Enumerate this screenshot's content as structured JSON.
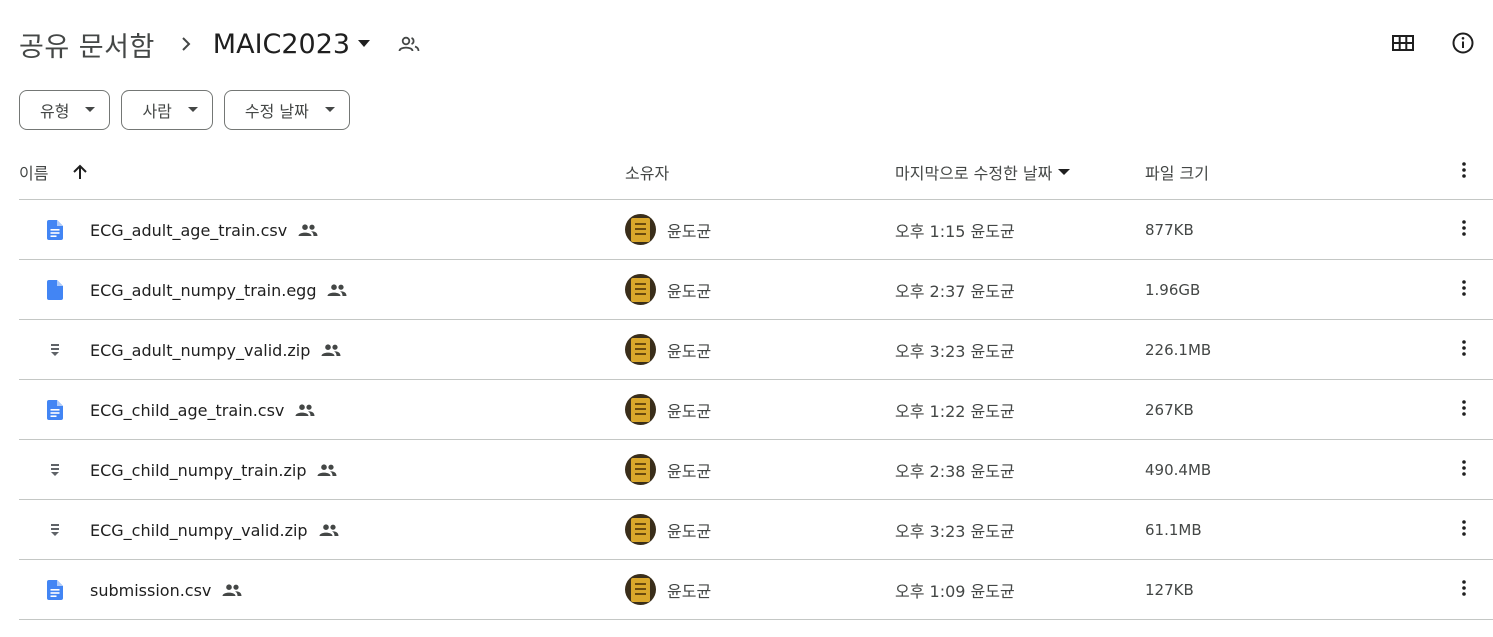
{
  "breadcrumb": {
    "root": "공유 문서함",
    "current": "MAIC2023"
  },
  "filters": [
    {
      "label": "유형"
    },
    {
      "label": "사람"
    },
    {
      "label": "수정 날짜"
    }
  ],
  "columns": {
    "name": "이름",
    "owner": "소유자",
    "modified": "마지막으로 수정한 날짜",
    "size": "파일 크기"
  },
  "files": [
    {
      "name": "ECG_adult_age_train.csv",
      "icon": "document-icon",
      "owner": "윤도균",
      "modified": "오후 1:15 윤도균",
      "size": "877KB"
    },
    {
      "name": "ECG_adult_numpy_train.egg",
      "icon": "file-icon",
      "owner": "윤도균",
      "modified": "오후 2:37 윤도균",
      "size": "1.96GB"
    },
    {
      "name": "ECG_adult_numpy_valid.zip",
      "icon": "zip-icon",
      "owner": "윤도균",
      "modified": "오후 3:23 윤도균",
      "size": "226.1MB"
    },
    {
      "name": "ECG_child_age_train.csv",
      "icon": "document-icon",
      "owner": "윤도균",
      "modified": "오후 1:22 윤도균",
      "size": "267KB"
    },
    {
      "name": "ECG_child_numpy_train.zip",
      "icon": "zip-icon",
      "owner": "윤도균",
      "modified": "오후 2:38 윤도균",
      "size": "490.4MB"
    },
    {
      "name": "ECG_child_numpy_valid.zip",
      "icon": "zip-icon",
      "owner": "윤도균",
      "modified": "오후 3:23 윤도균",
      "size": "61.1MB"
    },
    {
      "name": "submission.csv",
      "icon": "document-icon",
      "owner": "윤도균",
      "modified": "오후 1:09 윤도균",
      "size": "127KB"
    }
  ],
  "colors": {
    "doc_blue": "#4285f4",
    "zip_gray": "#5f6368",
    "divider": "#c4c7c5"
  }
}
